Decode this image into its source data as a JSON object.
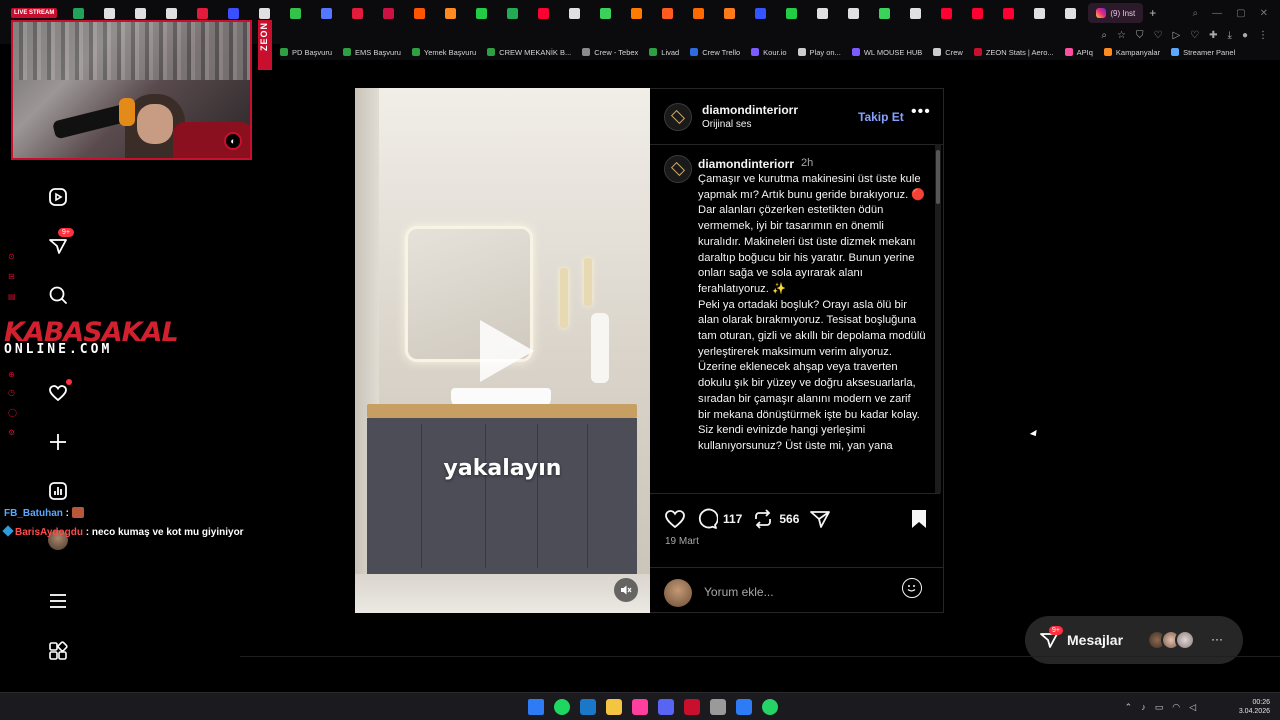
{
  "browser": {
    "live_tag": "LIVE STREAM",
    "active_tab": "(9) Inst",
    "tab_colors": [
      "#22a35a",
      "#e0e0e0",
      "#e0e0e0",
      "#e0e0e0",
      "#e21b3c",
      "#3a4fff",
      "#e0e0e0",
      "#33c24a",
      "#5577ff",
      "#e21b3c",
      "#cc1245",
      "#ff5500",
      "#ff8a1f",
      "#22cc44",
      "#22aa55",
      "#ff0033",
      "#e0e0e0",
      "#3ad25a",
      "#ff7a00",
      "#ff5a1f",
      "#ff6a00",
      "#ff7b1a",
      "#3355ff",
      "#22cc44",
      "#e0e0e0",
      "#e0e0e0",
      "#3ad25a",
      "#e0e0e0",
      "#ff0033",
      "#ff0033",
      "#ff0033",
      "#e0e0e0",
      "#e0e0e0"
    ]
  },
  "bookmarks": [
    {
      "label": "PD Başvuru",
      "color": "#2ea043"
    },
    {
      "label": "EMS Başvuru",
      "color": "#2ea043"
    },
    {
      "label": "Yemek Başvuru",
      "color": "#2ea043"
    },
    {
      "label": "CREW MEKANİK B...",
      "color": "#2ea043"
    },
    {
      "label": "Crew - Tebex",
      "color": "#8b8b8b"
    },
    {
      "label": "Livad",
      "color": "#2ea043"
    },
    {
      "label": "Crew Trello",
      "color": "#2d6be0"
    },
    {
      "label": "Kour.io",
      "color": "#7a5cff"
    },
    {
      "label": "Play on...",
      "color": "#cccccc"
    },
    {
      "label": "WL MOUSE HUB",
      "color": "#7a5cff"
    },
    {
      "label": "Crew",
      "color": "#cccccc"
    },
    {
      "label": "ZEON Stats | Aero...",
      "color": "#c8102e"
    },
    {
      "label": "APIq",
      "color": "#ff4fa0"
    },
    {
      "label": "Kampanyalar",
      "color": "#ff8a1f"
    },
    {
      "label": "Streamer Panel",
      "color": "#5aa9ff"
    }
  ],
  "stream": {
    "logo_line1": "KABASAKAL",
    "logo_line2": "ONLINE.COM",
    "sponsor": "ZEON",
    "chat": [
      {
        "user": "FB_Batuhan",
        "sep": " : ",
        "msg": ""
      },
      {
        "user": "BarisAydogdu",
        "sep": " : ",
        "msg": "neco kumaş ve kot mu giyiniyor"
      }
    ]
  },
  "nav": {
    "notif_badge": "9+"
  },
  "post": {
    "username": "diamondinteriorr",
    "audio": "Orijinal ses",
    "follow_label": "Takip Et",
    "caption_user": "diamondinteriorr",
    "caption_time": "2h",
    "caption": "Çamaşır ve kurutma makinesini üst üste kule yapmak mı? Artık bunu geride bırakıyoruz. 🔴\nDar alanları çözerken estetikten ödün vermemek, iyi bir tasarımın en önemli kuralıdır. Makineleri üst üste dizmek mekanı daraltıp boğucu bir his yaratır. Bunun yerine onları sağa ve sola ayırarak alanı ferahlatıyoruz. ✨\nPeki ya ortadaki boşluk? Orayı asla ölü bir alan olarak bırakmıyoruz. Tesisat boşluğuna tam oturan, gizli ve akıllı bir depolama modülü yerleştirerek maksimum verim alıyoruz. Üzerine eklenecek ahşap veya traverten dokulu şık bir yüzey ve doğru aksesuarlarla, sıradan bir çamaşır alanını modern ve zarif bir mekana dönüştürmek işte bu kadar kolay.\nSiz kendi evinizde hangi yerleşimi kullanıyorsunuz? Üst üste mi, yan yana",
    "video_caption": "yakalayın",
    "comments_count": "117",
    "reposts_count": "566",
    "date": "19 Mart",
    "comment_placeholder": "Yorum ekle..."
  },
  "messages": {
    "label": "Mesajlar",
    "badge": "9+"
  },
  "taskbar": {
    "time": "00:26",
    "date": "3.04.2026",
    "apps": [
      "#2d7cf6",
      "#1ed760",
      "#1b78c9",
      "#f4c542",
      "#ff3fa0",
      "#5865f2",
      "#c8102e",
      "#9a9a9a",
      "#2d7cf6",
      "#25d366"
    ]
  }
}
